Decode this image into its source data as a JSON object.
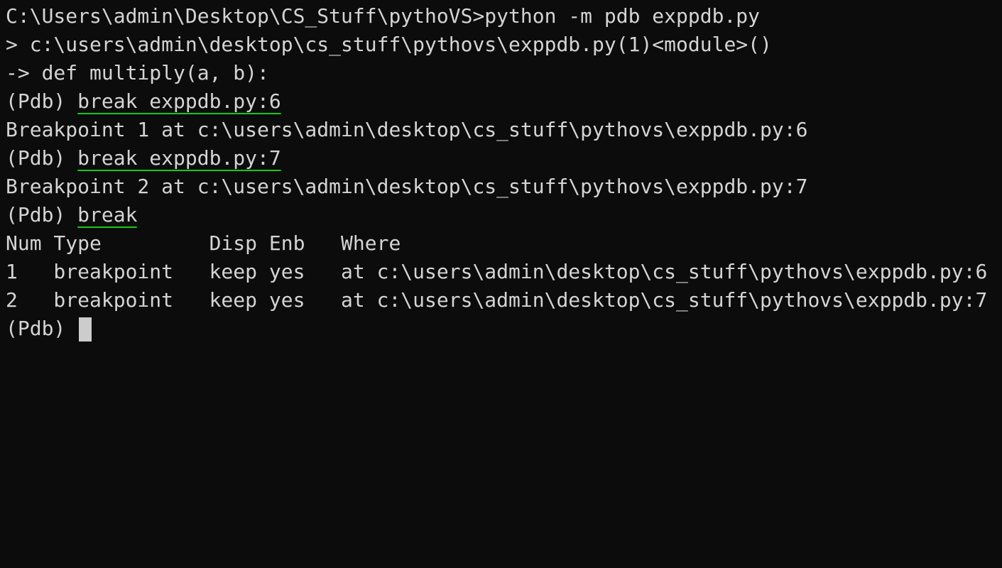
{
  "terminal": {
    "background": "#0c0c0c",
    "foreground": "#d4d4d4",
    "highlight_color": "#17c917",
    "lines": {
      "l0": "C:\\Users\\admin\\Desktop\\CS_Stuff\\pythoVS>python -m pdb exppdb.py",
      "l1": "> c:\\users\\admin\\desktop\\cs_stuff\\pythovs\\exppdb.py(1)<module>()",
      "l2": "-> def multiply(a, b):",
      "l3_prompt": "(Pdb) ",
      "l3_cmd": "break exppdb.py:6",
      "l4": "Breakpoint 1 at c:\\users\\admin\\desktop\\cs_stuff\\pythovs\\exppdb.py:6",
      "l5_prompt": "(Pdb) ",
      "l5_cmd": "break exppdb.py:7",
      "l6": "Breakpoint 2 at c:\\users\\admin\\desktop\\cs_stuff\\pythovs\\exppdb.py:7",
      "l7_prompt": "(Pdb) ",
      "l7_cmd": "break",
      "l8": "Num Type         Disp Enb   Where",
      "l9": "1   breakpoint   keep yes   at c:\\users\\admin\\desktop\\cs_stuff\\pythovs\\exppdb.py:6",
      "l10": "2   breakpoint   keep yes   at c:\\users\\admin\\desktop\\cs_stuff\\pythovs\\exppdb.py:7",
      "l11_prompt": "(Pdb) "
    }
  }
}
